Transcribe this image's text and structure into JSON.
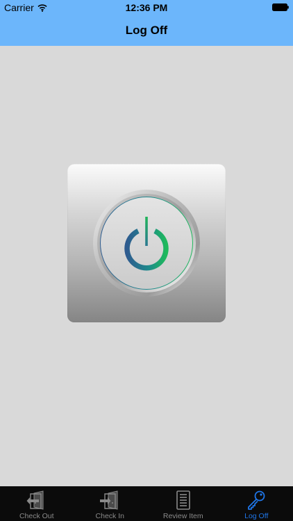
{
  "status_bar": {
    "carrier": "Carrier",
    "time": "12:36 PM"
  },
  "nav": {
    "title": "Log Off"
  },
  "tabs": [
    {
      "label": "Check Out",
      "icon": "check-out-icon",
      "active": false
    },
    {
      "label": "Check In",
      "icon": "check-in-icon",
      "active": false
    },
    {
      "label": "Review Item",
      "icon": "document-list-icon",
      "active": false
    },
    {
      "label": "Log Off",
      "icon": "key-icon",
      "active": true
    }
  ],
  "colors": {
    "nav_bar": "#6cb6fb",
    "background": "#d9d9d9",
    "tab_bar": "#0b0b0b",
    "active_tab": "#1f76e8",
    "inactive_tab": "#8a8a8a"
  }
}
